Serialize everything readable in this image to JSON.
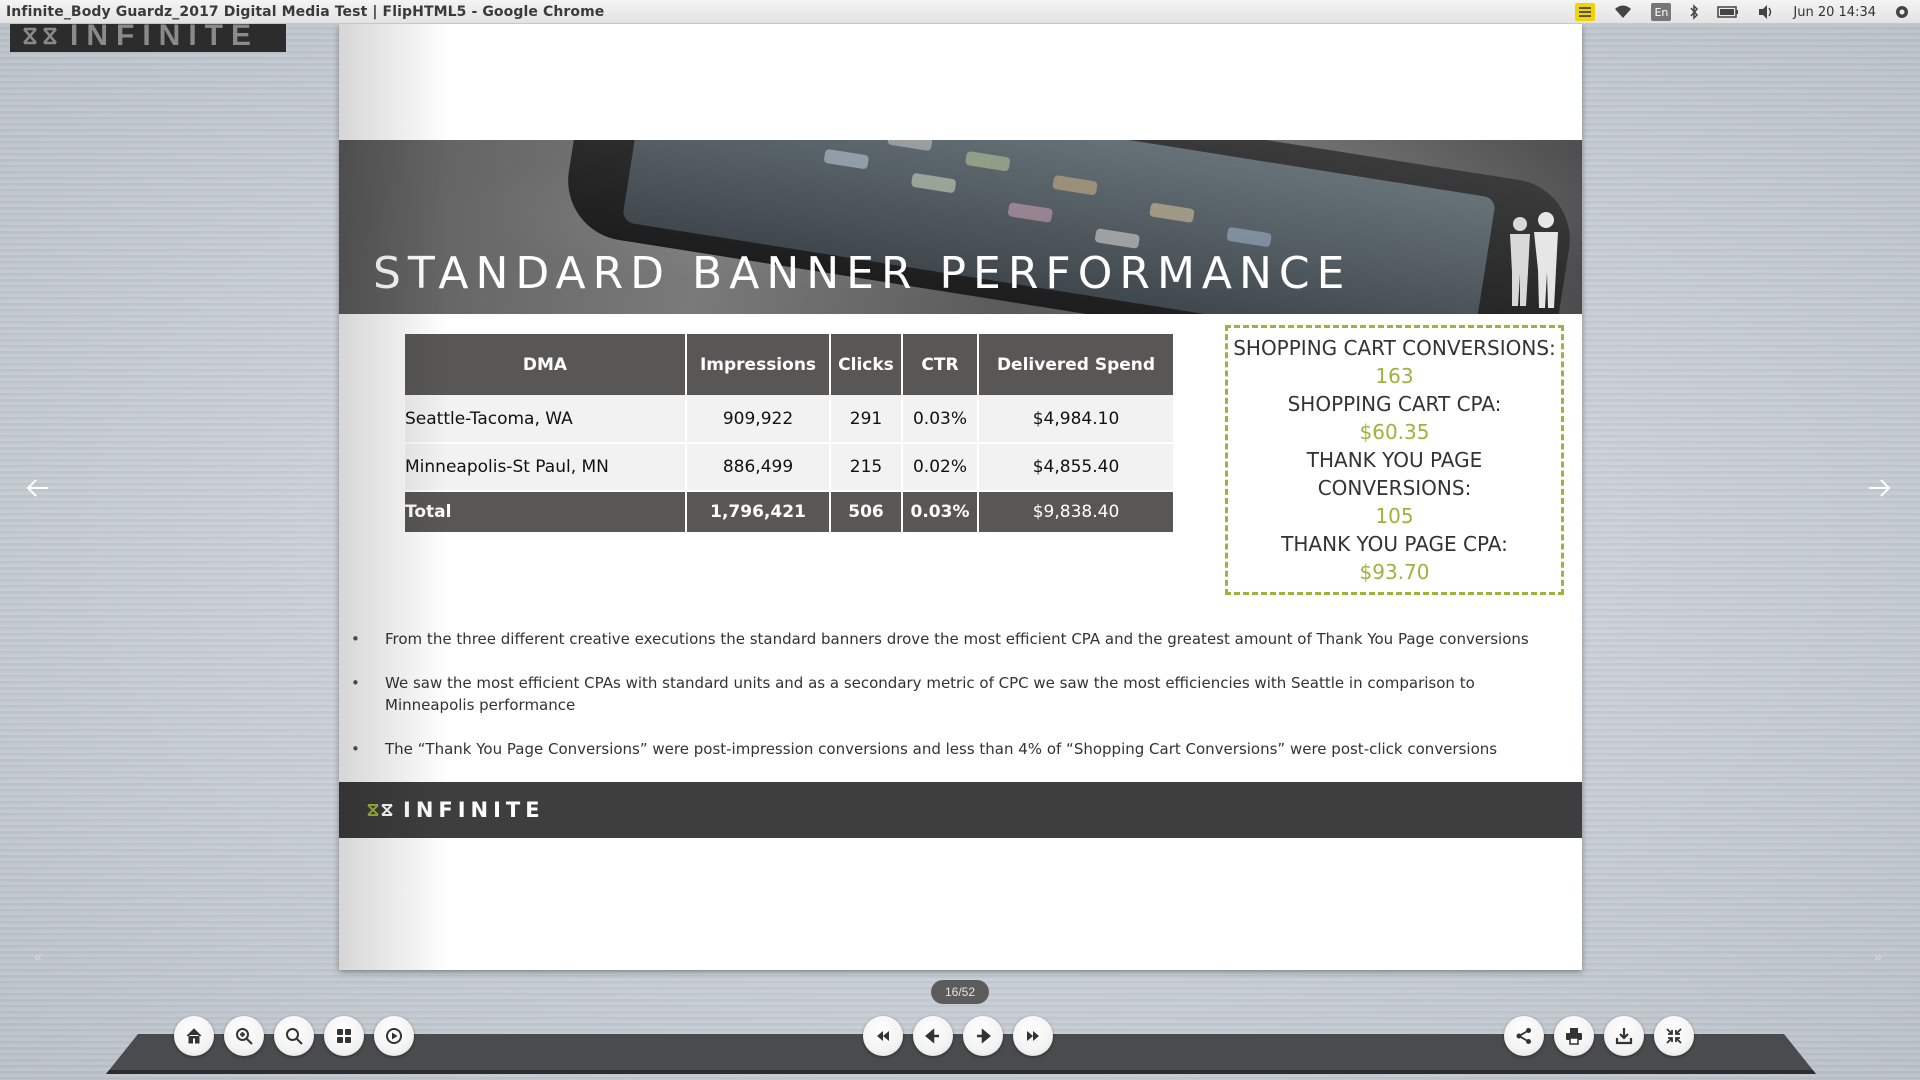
{
  "window": {
    "title": "Infinite_Body Guardz_2017 Digital Media Test | FlipHTML5 - Google Chrome",
    "lang": "En",
    "clock": "Jun 20 14:34"
  },
  "brand": {
    "logo_text": "INFINITE"
  },
  "slide": {
    "banner_title": "STANDARD BANNER PERFORMANCE",
    "table": {
      "headers": [
        "DMA",
        "Impressions",
        "Clicks",
        "CTR",
        "Delivered Spend"
      ],
      "rows": [
        [
          "Seattle-Tacoma, WA",
          "909,922",
          "291",
          "0.03%",
          "$4,984.10"
        ],
        [
          "Minneapolis-St Paul, MN",
          "886,499",
          "215",
          "0.02%",
          "$4,855.40"
        ]
      ],
      "total": [
        "Total",
        "1,796,421",
        "506",
        "0.03%",
        "$9,838.40"
      ]
    },
    "conversions": {
      "cart_conv_label": "SHOPPING CART CONVERSIONS:",
      "cart_conv_value": "163",
      "cart_cpa_label": "SHOPPING CART CPA:",
      "cart_cpa_value": "$60.35",
      "ty_conv_label": "THANK YOU PAGE CONVERSIONS:",
      "ty_conv_value": "105",
      "ty_cpa_label": "THANK YOU PAGE CPA:",
      "ty_cpa_value": "$93.70"
    },
    "bullets": [
      "From the three different creative executions the standard banners drove the most efficient CPA and the greatest amount of Thank You Page conversions",
      "We saw the most efficient CPAs with standard units and as a secondary metric of CPC we saw the most efficiencies with Seattle in comparison to Minneapolis performance",
      "The “Thank You Page Conversions” were post-impression conversions and less than 4% of “Shopping Cart Conversions” were post-click conversions"
    ],
    "footer_logo": "INFINITE"
  },
  "viewer": {
    "page_indicator": "16/52",
    "left_tools": [
      "home-icon",
      "zoom-in-icon",
      "search-icon",
      "thumbnails-icon",
      "autoplay-icon"
    ],
    "nav_tools": [
      "first-page-icon",
      "prev-page-icon",
      "next-page-icon",
      "last-page-icon"
    ],
    "right_tools": [
      "share-icon",
      "print-icon",
      "download-icon",
      "fullscreen-icon"
    ]
  },
  "colors": {
    "accent_green": "#9bb53a",
    "table_header": "#595656",
    "footer": "#3f3e3e"
  }
}
